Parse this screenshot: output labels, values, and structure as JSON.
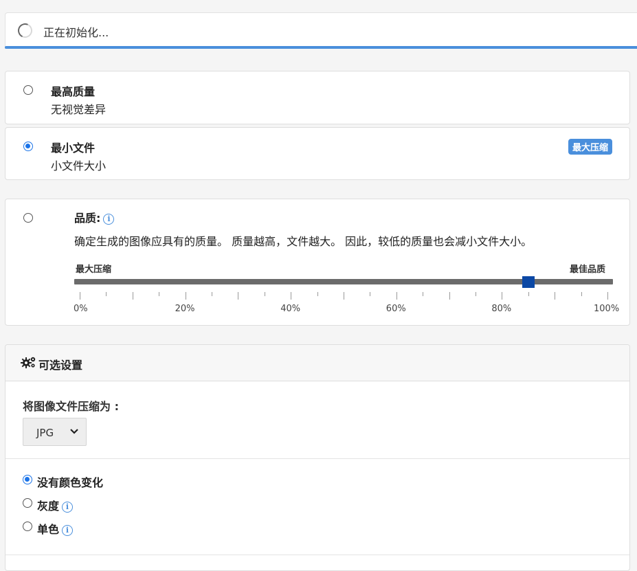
{
  "status": {
    "text": "正在初始化..."
  },
  "modes": [
    {
      "title": "最高质量",
      "subtitle": "无视觉差异",
      "selected": false
    },
    {
      "title": "最小文件",
      "subtitle": "小文件大小",
      "selected": true,
      "badge": "最大压缩"
    }
  ],
  "quality": {
    "label": "品质:",
    "description": "确定生成的图像应具有的质量。 质量越高，文件越大。 因此，较低的质量也会减小文件大小。",
    "min_label": "最大压缩",
    "max_label": "最佳品质",
    "value_percent": 85,
    "tick_labels": [
      "0%",
      "20%",
      "40%",
      "60%",
      "80%",
      "100%"
    ],
    "selected": false
  },
  "optional_settings": {
    "title": "可选设置",
    "compress_label": "将图像文件压缩为 :",
    "format_value": "JPG",
    "color_options": [
      {
        "label": "没有颜色变化",
        "selected": true,
        "info": false
      },
      {
        "label": "灰度",
        "selected": false,
        "info": true
      },
      {
        "label": "单色",
        "selected": false,
        "info": true
      }
    ]
  },
  "icons": {
    "spinner": "loading-spinner-icon",
    "gear": "gears-icon",
    "info": "info-icon",
    "caret": "chevron-down-icon"
  },
  "colors": {
    "accent": "#4a8fdc",
    "radio": "#1a73e8",
    "thumb": "#0b48a5",
    "track": "#6b6b6b"
  }
}
